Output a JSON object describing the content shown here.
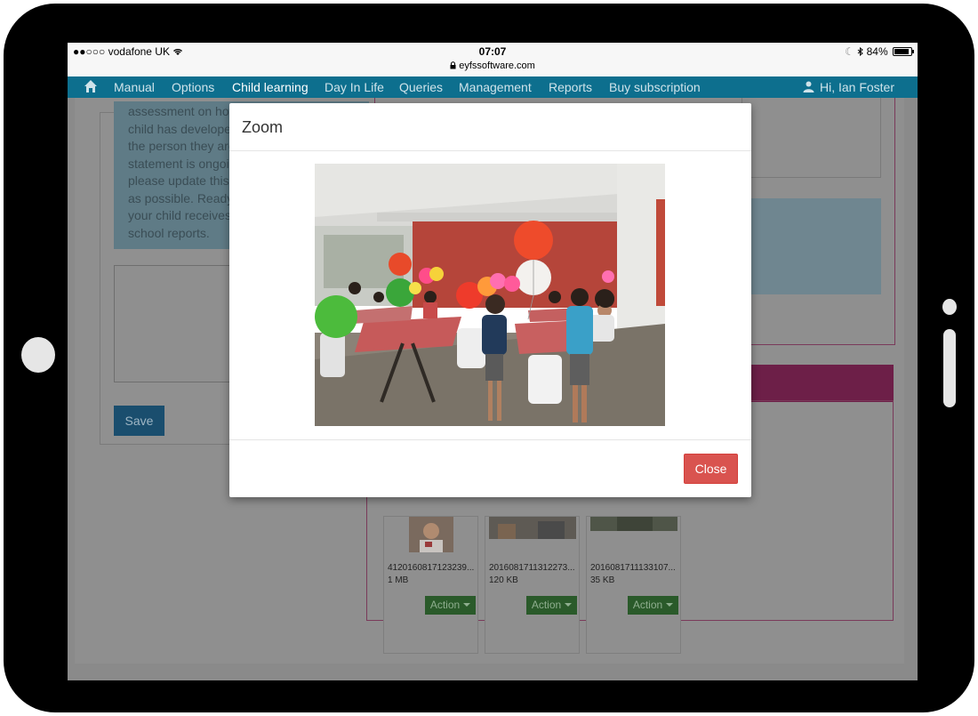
{
  "status_bar": {
    "carrier": "vodafone UK",
    "time": "07:07",
    "url": "eyfssoftware.com",
    "battery": "84%"
  },
  "nav": {
    "items": [
      {
        "label": "Manual"
      },
      {
        "label": "Options"
      },
      {
        "label": "Child learning",
        "active": true
      },
      {
        "label": "Day In Life"
      },
      {
        "label": "Queries"
      },
      {
        "label": "Management"
      },
      {
        "label": "Reports"
      },
      {
        "label": "Buy subscription"
      }
    ],
    "user_greeting": "Hi, Ian Foster"
  },
  "background_page": {
    "info_text_lines": [
      "assessment on how you feel your",
      "child has developed",
      "the person they are",
      "statement is ongoin",
      "please update this s",
      "as possible. Ready",
      "your child receives t",
      "school reports."
    ],
    "save_label": "Save",
    "files": [
      {
        "name": "4120160817123239...",
        "size": "1 MB",
        "action_label": "Action"
      },
      {
        "name": "2016081711312273...",
        "size": "120 KB",
        "action_label": "Action"
      },
      {
        "name": "2016081711133107...",
        "size": "35 KB",
        "action_label": "Action"
      }
    ]
  },
  "modal": {
    "title": "Zoom",
    "close_label": "Close"
  },
  "colors": {
    "nav_bg": "#0d6f8e",
    "close_button": "#d9534f",
    "action_button": "#5cb85c",
    "save_button": "#337ab7",
    "pink_accent": "#c2185b"
  }
}
